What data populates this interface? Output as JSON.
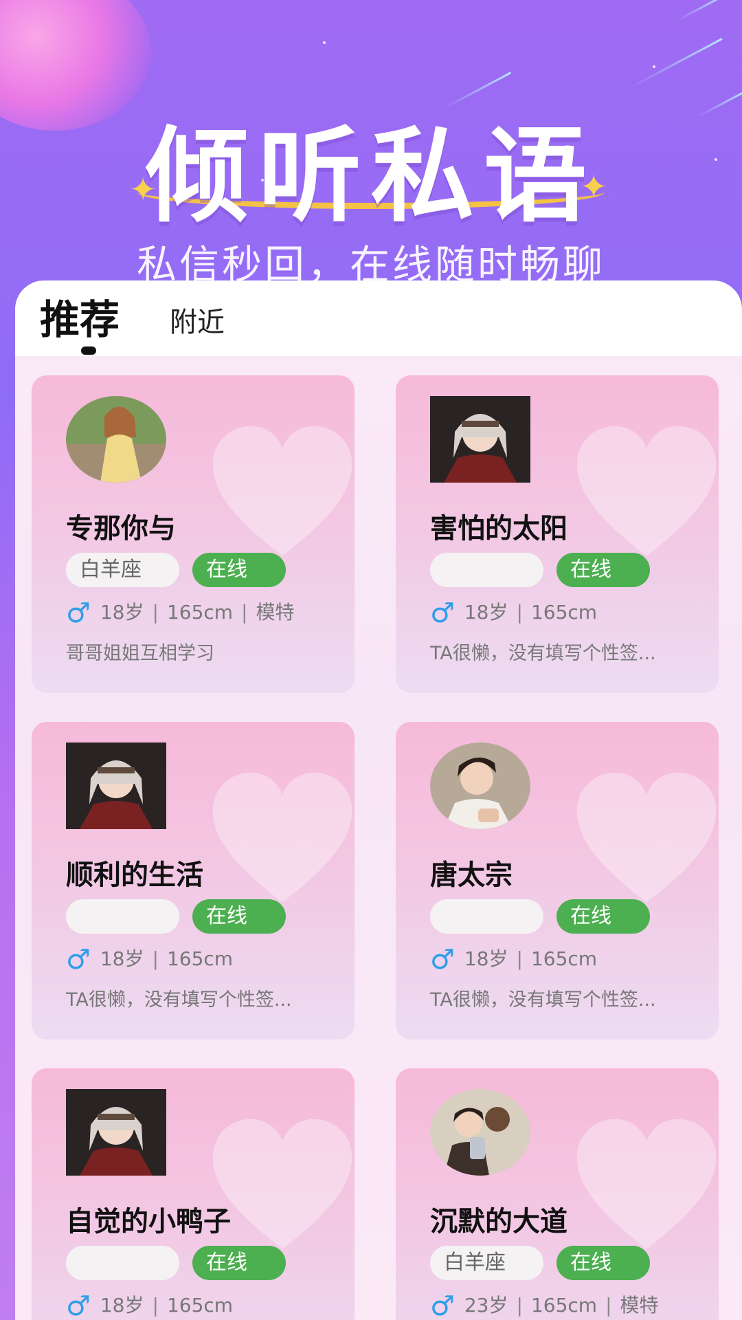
{
  "hero": {
    "title": "倾听私语",
    "subtitle": "私信秒回，在线随时畅聊"
  },
  "tabs": [
    {
      "label": "推荐",
      "active": true
    },
    {
      "label": "附近",
      "active": false
    }
  ],
  "colors": {
    "online_green": "#4caf50",
    "male_blue": "#2f9ee8",
    "card_pink": "#f6b9d9",
    "banner_purple": "#9a6cf5"
  },
  "profiles": [
    {
      "name": "专那你与",
      "zodiac": "白羊座",
      "status": "在线",
      "gender_icon": "male-icon",
      "gender_symbol": "♂",
      "age": "18岁",
      "height": "165cm",
      "job": "模特",
      "signature": "哥哥姐姐互相学习"
    },
    {
      "name": "害怕的太阳",
      "zodiac": "",
      "status": "在线",
      "gender_icon": "male-icon",
      "gender_symbol": "♂",
      "age": "18岁",
      "height": "165cm",
      "job": "",
      "signature": "TA很懒，没有填写个性签..."
    },
    {
      "name": "顺利的生活",
      "zodiac": "",
      "status": "在线",
      "gender_icon": "male-icon",
      "gender_symbol": "♂",
      "age": "18岁",
      "height": "165cm",
      "job": "",
      "signature": "TA很懒，没有填写个性签..."
    },
    {
      "name": "唐太宗",
      "zodiac": "",
      "status": "在线",
      "gender_icon": "male-icon",
      "gender_symbol": "♂",
      "age": "18岁",
      "height": "165cm",
      "job": "",
      "signature": "TA很懒，没有填写个性签..."
    },
    {
      "name": "自觉的小鸭子",
      "zodiac": "",
      "status": "在线",
      "gender_icon": "male-icon",
      "gender_symbol": "♂",
      "age": "18岁",
      "height": "165cm",
      "job": "",
      "signature": ""
    },
    {
      "name": "沉默的大道",
      "zodiac": "白羊座",
      "status": "在线",
      "gender_icon": "male-icon",
      "gender_symbol": "♂",
      "age": "23岁",
      "height": "165cm",
      "job": "模特",
      "signature": ""
    }
  ]
}
